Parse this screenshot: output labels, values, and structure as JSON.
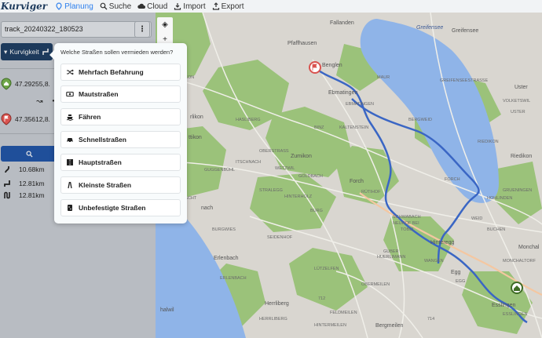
{
  "brand": "Kurviger",
  "nav": [
    {
      "label": "Planung",
      "icon": "map-pin-icon",
      "active": true
    },
    {
      "label": "Suche",
      "icon": "search-icon"
    },
    {
      "label": "Cloud",
      "icon": "cloud-icon"
    },
    {
      "label": "Import",
      "icon": "import-icon"
    },
    {
      "label": "Export",
      "icon": "export-icon"
    }
  ],
  "track": {
    "name": "track_20240322_180523"
  },
  "route_mode": {
    "label": "Kurvigkeit"
  },
  "waypoints": [
    {
      "coords": "47.29255,8.",
      "icon": "home-marker-icon"
    },
    {
      "coords": "47.35612,8.",
      "icon": "flag-marker-icon"
    }
  ],
  "stats": [
    {
      "value": "10.68km",
      "icon": "curvy-road-icon"
    },
    {
      "value": "12.81km",
      "icon": "route-icon"
    },
    {
      "value": "12.81km",
      "icon": "winding-road-icon"
    }
  ],
  "avoid_popover": {
    "title": "Welche Straßen sollen vermieden werden?",
    "options": [
      {
        "label": "Mehrfach Befahrung",
        "icon": "shuffle-icon"
      },
      {
        "label": "Mautstraßen",
        "icon": "money-icon"
      },
      {
        "label": "Fähren",
        "icon": "ferry-icon"
      },
      {
        "label": "Schnellstraßen",
        "icon": "car-icon"
      },
      {
        "label": "Hauptstraßen",
        "icon": "main-road-icon"
      },
      {
        "label": "Kleinste Straßen",
        "icon": "narrow-road-icon"
      },
      {
        "label": "Unbefestigte Straßen",
        "icon": "unpaved-road-icon"
      }
    ]
  },
  "map_labels": [
    "Fallanden",
    "Greifensee",
    "Pfaffhausen",
    "Benglen",
    "Ebmatingen",
    "Uster",
    "Riedikon",
    "Zumikon",
    "Forch",
    "Hinteregg",
    "Egg",
    "Esslingen",
    "Monchal",
    "Erlenbach",
    "Herrliberg",
    "Bergmeilen",
    "Greifensee",
    "rlikon",
    "ttikon",
    "nach",
    "halwil",
    "712",
    "714",
    "EBMATINGEN",
    "STRALEGG",
    "HINTERHOLZ",
    "SEIDENHOF",
    "GUBER",
    "HUERLIMANN",
    "BURG",
    "TOBEL",
    "SCHWABACH",
    "NEUHOF BEI",
    "FORCH",
    "WEID",
    "KALTENSTEIN",
    "HASLIBERG",
    "RÜTIHOF",
    "BERGWEID",
    "OBERSTRASS",
    "RIEDIKON",
    "MONCHALTORF",
    "EGG",
    "VOLKETSWIL",
    "ESSLINGEN",
    "HOHLINDEN",
    "BURGWIES",
    "LÜTZELFEN",
    "OBERMEILEN",
    "FELDMEILEN",
    "HERRLIBERG",
    "ERLENBACH",
    "WETZWIL",
    "GOLDBACH",
    "MAUR",
    "ZOLLIKON",
    "BINZ",
    "KÜSNACHT",
    "ITSCHNACH",
    "GUGGENBÜHL",
    "HINTERMEILEN",
    "WANGEN",
    "GREIFENSEESTRASSE",
    "USTER",
    "BUCHEN",
    "GRUENINGEN"
  ],
  "colors": {
    "accent": "#2f80ed",
    "nav_dark": "#1d3a5c",
    "route": "#3a66c4",
    "lake": "#8fb4e8",
    "forest": "#8fbf6a"
  }
}
